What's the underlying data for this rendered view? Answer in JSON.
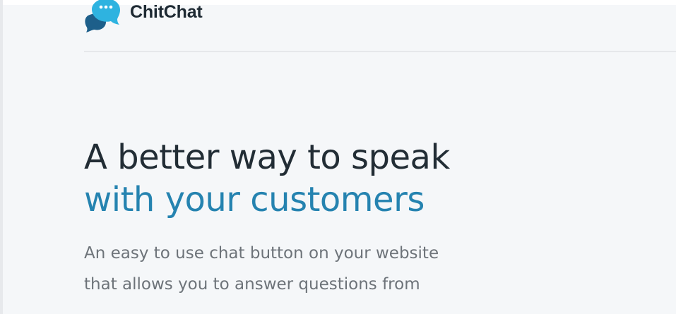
{
  "brand": {
    "name": "ChitChat",
    "logo_icon": "chat-bubble-icon",
    "colors": {
      "logo_dark": "#1d5f8a",
      "logo_light": "#2eb3e0"
    }
  },
  "hero": {
    "headline_line1": "A better way to speak",
    "headline_line2": "with your customers",
    "description_line1": "An easy to use chat button on your website",
    "description_line2": "that allows you to answer questions from"
  },
  "theme": {
    "accent_color": "#2583b0",
    "heading_color": "#222d35",
    "body_color": "#6d7379",
    "background": "#f5f7f9"
  }
}
